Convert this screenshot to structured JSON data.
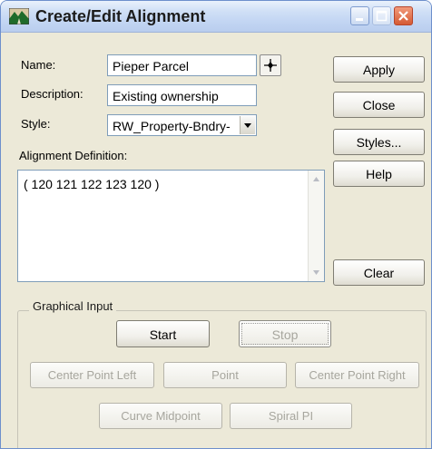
{
  "window": {
    "title": "Create/Edit Alignment",
    "icon": "mountain-road-app-icon",
    "controls": [
      "minimize-icon",
      "maximize-icon",
      "close-icon"
    ]
  },
  "form": {
    "name_label": "Name:",
    "name_value": "Pieper Parcel",
    "description_label": "Description:",
    "description_value": "Existing ownership",
    "style_label": "Style:",
    "style_value": "RW_Property-Bndry-",
    "definition_label": "Alignment Definition:",
    "definition_value": "( 120 121 122 123 120 )"
  },
  "buttons": {
    "apply": "Apply",
    "close": "Close",
    "styles": "Styles...",
    "help": "Help",
    "clear": "Clear"
  },
  "graphical_input": {
    "legend": "Graphical Input",
    "start": "Start",
    "stop": "Stop",
    "center_point_left": "Center Point Left",
    "point": "Point",
    "center_point_right": "Center Point Right",
    "curve_midpoint": "Curve Midpoint",
    "spiral_pi": "Spiral PI"
  },
  "colors": {
    "dialog_bg": "#ece9d8",
    "titlebar": "#c3d6f3",
    "close_button": "#d55a33",
    "disabled_text": "#a7a69e"
  }
}
